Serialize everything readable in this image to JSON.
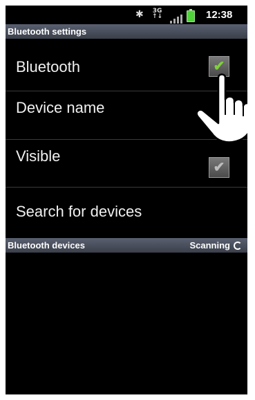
{
  "status_bar": {
    "bluetooth_icon": "bluetooth-icon",
    "network_top": "3G",
    "network_bottom": "↑↓",
    "signal_icon": "signal-icon",
    "battery_icon": "battery-icon",
    "time": "12:38"
  },
  "header": {
    "title": "Bluetooth settings"
  },
  "settings": {
    "bluetooth": {
      "label": "Bluetooth",
      "checked": true,
      "check_color": "#7fd13b"
    },
    "device_name": {
      "label": "Device name"
    },
    "visible": {
      "label": "Visible",
      "checked": true,
      "check_color": "#bdbdbd"
    },
    "search": {
      "label": "Search for devices"
    }
  },
  "devices": {
    "title": "Bluetooth devices",
    "status": "Scanning"
  },
  "overlay": {
    "icon": "pointing-hand-icon"
  }
}
